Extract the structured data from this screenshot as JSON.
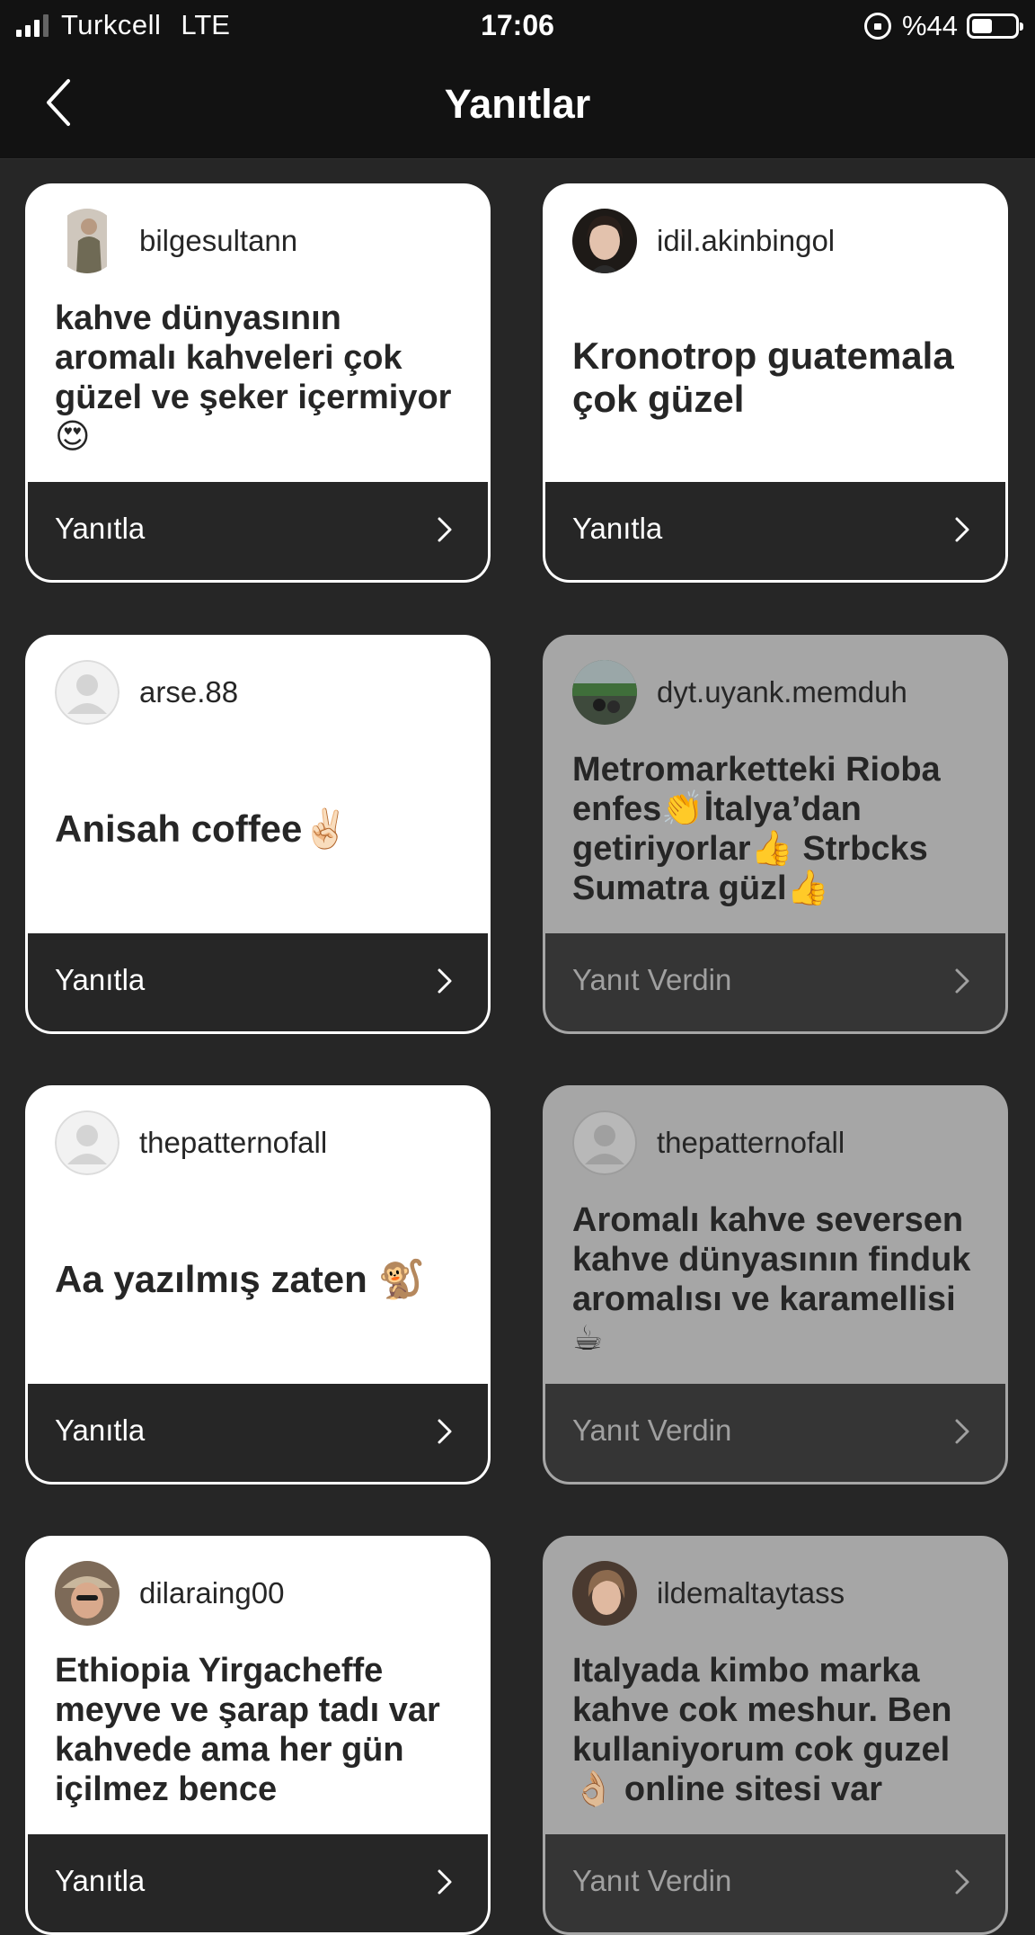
{
  "status_bar": {
    "carrier": "Turkcell",
    "network": "LTE",
    "time": "17:06",
    "battery": "%44"
  },
  "header": {
    "title": "Yanıtlar"
  },
  "cards": [
    {
      "username": "bilgesultann",
      "text": "kahve dünyasının aromalı kahveleri çok güzel ve şeker içermiyor 😍",
      "action": "Yanıtla",
      "avatar": "photo"
    },
    {
      "username": "idil.akinbingol",
      "text": "Kronotrop guatemala çok güzel",
      "action": "Yanıtla",
      "avatar": "photo"
    },
    {
      "username": "arse.88",
      "text": "Anisah coffee✌🏻",
      "action": "Yanıtla",
      "avatar": "default"
    },
    {
      "username": "dyt.uyank.memduh",
      "text": "Metromarketteki Rioba enfes👏İtalya’dan getiriyorlar👍 Strbcks Sumatra güzl👍",
      "action": "Yanıt Verdin",
      "avatar": "photo"
    },
    {
      "username": "thepatternofall",
      "text": "Aa yazılmış zaten 🐒",
      "action": "Yanıtla",
      "avatar": "default"
    },
    {
      "username": "thepatternofall",
      "text": "Aromalı kahve seversen kahve dünyasının finduk aromalısı ve karamellisi ☕",
      "action": "Yanıt Verdin",
      "avatar": "default"
    },
    {
      "username": "dilaraing00",
      "text": "Ethiopia Yirgacheffe meyve ve şarap tadı var kahvede ama her gün içilmez bence",
      "action": "Yanıtla",
      "avatar": "photo"
    },
    {
      "username": "ildemaltaytass",
      "text": "Italyada kimbo marka kahve cok meshur. Ben kullaniyorum cok guzel👌🏼 online sitesi var",
      "action": "Yanıt Verdin",
      "avatar": "photo"
    }
  ],
  "colors": {
    "background": "#262626",
    "bar": "#121212",
    "card": "#ffffff",
    "answered_card": "#a6a6a6"
  }
}
